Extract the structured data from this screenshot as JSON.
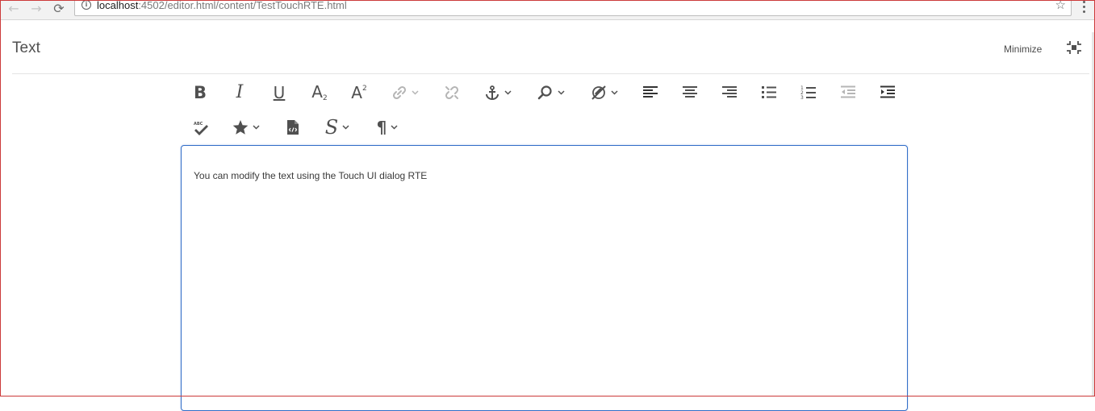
{
  "browser": {
    "url_host": "localhost",
    "url_rest": ":4502/editor.html/content/TestTouchRTE.html",
    "icons": {
      "back": "back-arrow-icon",
      "forward": "forward-arrow-icon",
      "reload": "reload-icon",
      "info": "info-icon",
      "bookmark": "star-icon",
      "menu": "kebab-menu-icon"
    }
  },
  "dialog": {
    "title": "Text",
    "minimize_label": "Minimize",
    "fullscreen_icon": "fullscreen-exit-icon"
  },
  "toolbar": {
    "row1": [
      {
        "name": "bold-icon",
        "glyph": "B"
      },
      {
        "name": "italic-icon",
        "glyph": "I"
      },
      {
        "name": "underline-icon",
        "glyph": "U"
      },
      {
        "name": "subscript-icon",
        "glyph": "A"
      },
      {
        "name": "superscript-icon",
        "glyph": "A"
      },
      {
        "name": "link-icon",
        "disabled": true,
        "dropdown": true
      },
      {
        "name": "unlink-icon",
        "disabled": true
      },
      {
        "name": "anchor-icon",
        "dropdown": true
      },
      {
        "name": "find-icon",
        "dropdown": true
      },
      {
        "name": "paste-edit-icon",
        "dropdown": true
      },
      {
        "name": "align-left-icon"
      },
      {
        "name": "align-center-icon"
      },
      {
        "name": "align-right-icon"
      },
      {
        "name": "bullet-list-icon"
      },
      {
        "name": "numbered-list-icon"
      },
      {
        "name": "outdent-icon",
        "disabled": true
      },
      {
        "name": "indent-icon"
      }
    ],
    "row2": [
      {
        "name": "spellcheck-icon"
      },
      {
        "name": "special-characters-icon",
        "dropdown": true
      },
      {
        "name": "source-edit-icon"
      },
      {
        "name": "style-icon",
        "glyph": "S",
        "dropdown": true
      },
      {
        "name": "paragraph-format-icon",
        "glyph": "¶",
        "dropdown": true
      }
    ]
  },
  "editor": {
    "text": "You can modify the text using the Touch UI dialog RTE"
  },
  "colors": {
    "editor_border": "#326ec8",
    "frame_border": "#cc3a3a",
    "icon": "#505050",
    "icon_disabled": "#b5b5b5"
  }
}
